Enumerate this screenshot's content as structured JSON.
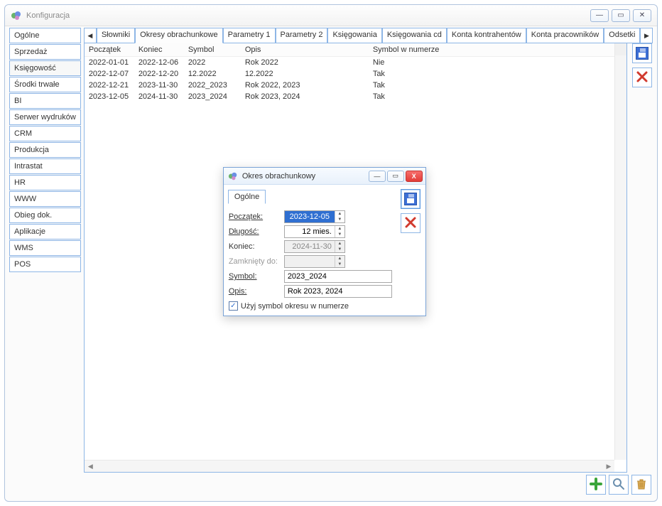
{
  "window": {
    "title": "Konfiguracja",
    "controls": {
      "min": "—",
      "max": "▭",
      "close": "✕"
    }
  },
  "sidebar": {
    "items": [
      {
        "label": "Ogólne",
        "active": false
      },
      {
        "label": "Sprzedaż",
        "active": false
      },
      {
        "label": "Księgowość",
        "active": true
      },
      {
        "label": "Środki trwałe",
        "active": false
      },
      {
        "label": "BI",
        "active": false
      },
      {
        "label": "Serwer wydruków",
        "active": false
      },
      {
        "label": "CRM",
        "active": false
      },
      {
        "label": "Produkcja",
        "active": false
      },
      {
        "label": "Intrastat",
        "active": false
      },
      {
        "label": "HR",
        "active": false
      },
      {
        "label": "WWW",
        "active": false
      },
      {
        "label": "Obieg dok.",
        "active": false
      },
      {
        "label": "Aplikacje",
        "active": false
      },
      {
        "label": "WMS",
        "active": false
      },
      {
        "label": "POS",
        "active": false
      }
    ]
  },
  "tabs": {
    "scroll_left": "◀",
    "scroll_right": "▶",
    "items": [
      {
        "label": "Słowniki"
      },
      {
        "label": "Okresy obrachunkowe",
        "active": true
      },
      {
        "label": "Parametry 1"
      },
      {
        "label": "Parametry 2"
      },
      {
        "label": "Księgowania"
      },
      {
        "label": "Księgowania cd"
      },
      {
        "label": "Konta kontrahentów"
      },
      {
        "label": "Konta pracowników"
      },
      {
        "label": "Odsetki"
      }
    ]
  },
  "grid": {
    "columns": [
      "Początek",
      "Koniec",
      "Symbol",
      "Opis",
      "Symbol w numerze"
    ],
    "rows": [
      {
        "start": "2022-01-01",
        "end": "2022-12-06",
        "symbol": "2022",
        "desc": "Rok 2022",
        "inno": "Nie"
      },
      {
        "start": "2022-12-07",
        "end": "2022-12-20",
        "symbol": "12.2022",
        "desc": "12.2022",
        "inno": "Tak"
      },
      {
        "start": "2022-12-21",
        "end": "2023-11-30",
        "symbol": "2022_2023",
        "desc": "Rok 2022, 2023",
        "inno": "Tak"
      },
      {
        "start": "2023-12-05",
        "end": "2024-11-30",
        "symbol": "2023_2024",
        "desc": "Rok 2023, 2024",
        "inno": "Tak"
      }
    ]
  },
  "tools": {
    "save": "save",
    "delete": "delete",
    "add": "add",
    "search": "search",
    "trash": "trash"
  },
  "dialog": {
    "title": "Okres obrachunkowy",
    "tab": "Ogólne",
    "fields": {
      "start_label": "Początek:",
      "start_value": "2023-12-05",
      "length_label": "Długość:",
      "length_value": "12 mies.",
      "end_label": "Koniec:",
      "end_value": "2024-11-30",
      "closed_label": "Zamknięty do:",
      "closed_value": "",
      "symbol_label": "Symbol:",
      "symbol_value": "2023_2024",
      "desc_label": "Opis:",
      "desc_value": "Rok 2023, 2024",
      "checkbox_label": "Użyj symbol okresu w numerze",
      "checkbox_checked": true
    }
  }
}
